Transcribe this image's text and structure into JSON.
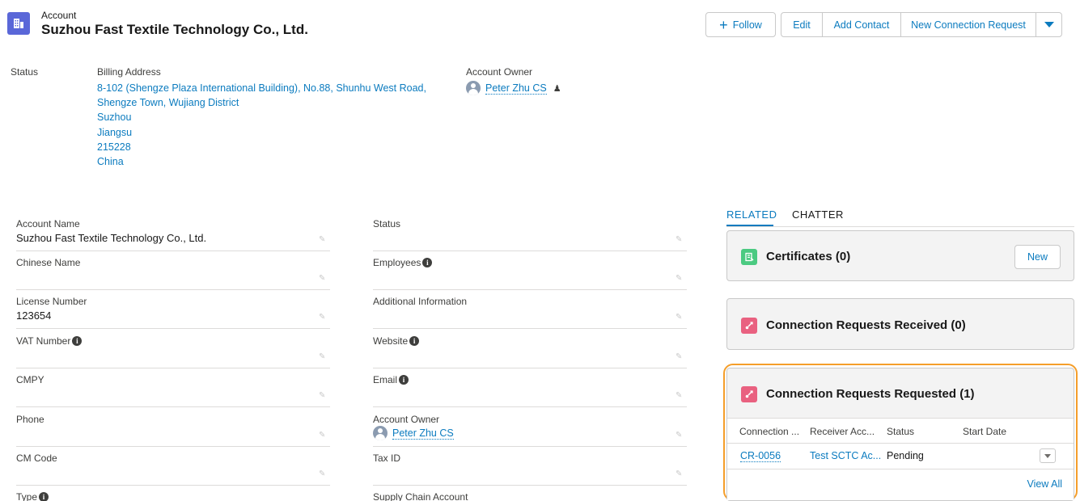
{
  "header": {
    "object_label": "Account",
    "title": "Suzhou Fast Textile Technology Co., Ltd.",
    "follow_label": "Follow",
    "actions": [
      "Edit",
      "Add Contact",
      "New Connection Request"
    ]
  },
  "highlights": {
    "status_label": "Status",
    "billing_label": "Billing Address",
    "billing_lines": [
      "8-102 (Shengze Plaza International Building), No.88, Shunhu West Road,",
      "Shengze Town, Wujiang District",
      "Suzhou",
      "Jiangsu",
      "215228",
      "China"
    ],
    "owner_label": "Account Owner",
    "owner_name": "Peter Zhu CS"
  },
  "details": {
    "left": [
      {
        "label": "Account Name",
        "value": "Suzhou Fast Textile Technology Co., Ltd.",
        "info": false
      },
      {
        "label": "Chinese Name",
        "value": "",
        "info": false
      },
      {
        "label": "License Number",
        "value": "123654",
        "info": false
      },
      {
        "label": "VAT Number",
        "value": "",
        "info": true
      },
      {
        "label": "CMPY",
        "value": "",
        "info": false
      },
      {
        "label": "Phone",
        "value": "",
        "info": false
      },
      {
        "label": "CM Code",
        "value": "",
        "info": false
      },
      {
        "label": "Type",
        "value": "",
        "info": true
      }
    ],
    "right": [
      {
        "label": "Status",
        "value": "",
        "info": false
      },
      {
        "label": "Employees",
        "value": "",
        "info": true
      },
      {
        "label": "Additional Information",
        "value": "",
        "info": false
      },
      {
        "label": "Website",
        "value": "",
        "info": true
      },
      {
        "label": "Email",
        "value": "",
        "info": true
      },
      {
        "label": "Account Owner",
        "value": "Peter Zhu CS",
        "info": false
      },
      {
        "label": "Tax ID",
        "value": "",
        "info": false
      },
      {
        "label": "Supply Chain Account",
        "value": "",
        "info": false
      }
    ]
  },
  "related": {
    "tabs": [
      "RELATED",
      "CHATTER"
    ],
    "active_tab": "RELATED",
    "certificates_title": "Certificates (0)",
    "certificates_new": "New",
    "received_title": "Connection Requests Received (0)",
    "requested_title": "Connection Requests Requested (1)",
    "columns": [
      "Connection ...",
      "Receiver Acc...",
      "Status",
      "Start Date"
    ],
    "rows": [
      {
        "connection": "CR-0056",
        "receiver": "Test SCTC Ac...",
        "status": "Pending",
        "start_date": ""
      }
    ],
    "view_all": "View All"
  },
  "colors": {
    "link": "#0b7bbf",
    "account_icon": "#5a67d8",
    "certificate_icon": "#4bca81",
    "connection_icon": "#e96180",
    "highlight_border": "#f59e2a"
  }
}
